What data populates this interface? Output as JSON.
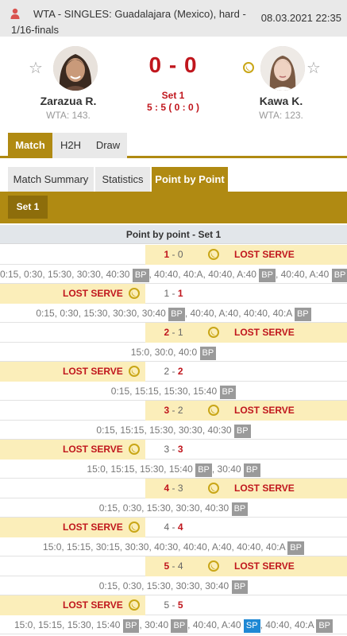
{
  "header": {
    "title": "WTA - SINGLES: Guadalajara (Mexico), hard - 1/16-finals",
    "datetime": "08.03.2021 22:35"
  },
  "match": {
    "home": {
      "name": "Zarazua R.",
      "rank": "WTA: 143."
    },
    "away": {
      "name": "Kawa K.",
      "rank": "WTA: 123."
    },
    "score": "0 - 0",
    "set_label": "Set 1",
    "set_score": "5 : 5 ( 0 : 0 )"
  },
  "tabs": {
    "match": "Match",
    "h2h": "H2H",
    "draw": "Draw"
  },
  "subtabs": {
    "summary": "Match Summary",
    "statistics": "Statistics",
    "pbp": "Point by Point"
  },
  "set_button": "Set 1",
  "pbp_title": "Point by point - Set 1",
  "lost_serve_label": "LOST SERVE",
  "games": [
    {
      "server": "away",
      "lost": "right",
      "home": "1",
      "away": "0",
      "won": "home",
      "points": [
        "0:15, 0:30, 15:30, 30:30, 40:30 ",
        "BP",
        ", 40:40, 40:A, 40:40, A:40 ",
        "BP",
        ", 40:40, A:40 ",
        "BP",
        ""
      ]
    },
    {
      "server": "home",
      "lost": "left",
      "home": "1",
      "away": "1",
      "won": "away",
      "points": [
        "0:15, 0:30, 15:30, 30:30, 30:40 ",
        "BP",
        ", 40:40, A:40, 40:40, 40:A ",
        "BP",
        ""
      ]
    },
    {
      "server": "away",
      "lost": "right",
      "home": "2",
      "away": "1",
      "won": "home",
      "points": [
        "15:0, 30:0, 40:0 ",
        "BP",
        ""
      ]
    },
    {
      "server": "home",
      "lost": "left",
      "home": "2",
      "away": "2",
      "won": "away",
      "points": [
        "0:15, 15:15, 15:30, 15:40 ",
        "BP",
        ""
      ]
    },
    {
      "server": "away",
      "lost": "right",
      "home": "3",
      "away": "2",
      "won": "home",
      "points": [
        "0:15, 15:15, 15:30, 30:30, 40:30 ",
        "BP",
        ""
      ]
    },
    {
      "server": "home",
      "lost": "left",
      "home": "3",
      "away": "3",
      "won": "away",
      "points": [
        "15:0, 15:15, 15:30, 15:40 ",
        "BP",
        ", 30:40 ",
        "BP",
        ""
      ]
    },
    {
      "server": "away",
      "lost": "right",
      "home": "4",
      "away": "3",
      "won": "home",
      "points": [
        "0:15, 0:30, 15:30, 30:30, 40:30 ",
        "BP",
        ""
      ]
    },
    {
      "server": "home",
      "lost": "left",
      "home": "4",
      "away": "4",
      "won": "away",
      "points": [
        "15:0, 15:15, 30:15, 30:30, 40:30, 40:40, A:40, 40:40, 40:A ",
        "BP",
        ""
      ]
    },
    {
      "server": "away",
      "lost": "right",
      "home": "5",
      "away": "4",
      "won": "home",
      "points": [
        "0:15, 0:30, 15:30, 30:30, 30:40 ",
        "BP",
        ""
      ]
    },
    {
      "server": "home",
      "lost": "left",
      "home": "5",
      "away": "5",
      "won": "away",
      "points": [
        "15:0, 15:15, 15:30, 15:40 ",
        "BP",
        ", 30:40 ",
        "BP",
        ", 40:40, A:40 ",
        "SP",
        ", 40:40, 40:A ",
        "BP",
        ""
      ]
    }
  ],
  "colors": {
    "accent": "#b08a12",
    "accent_dark": "#8d6d0b",
    "score_red": "#c0161d",
    "highlight": "#fbeeba",
    "sp_blue": "#1e88d4",
    "bp_gray": "#9a9a9a"
  },
  "icons": {
    "flag": "person-flag-icon",
    "favorite": "star-outline-icon",
    "serve": "tennis-ball-icon"
  }
}
